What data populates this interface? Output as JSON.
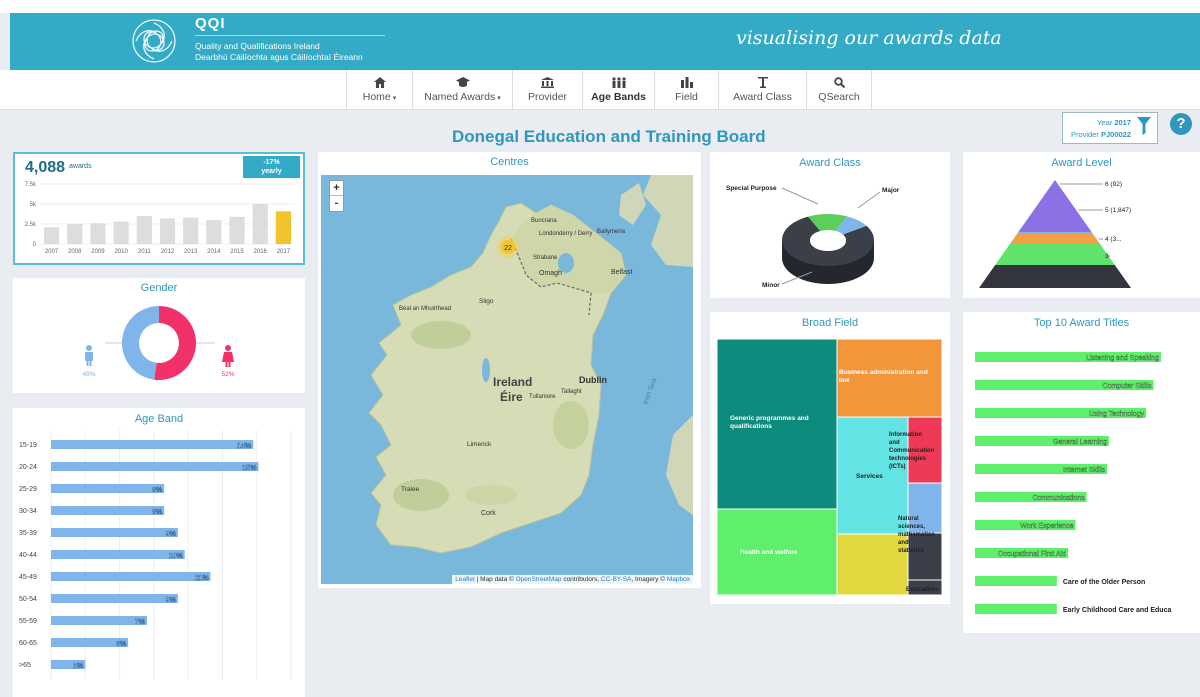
{
  "header": {
    "brand_name": "QQI",
    "brand_line1": "Quality and Qualifications Ireland",
    "brand_line2": "Dearbhú Cáilíochta agus Cáilíochtaí Éireann",
    "tagline": "visualising our awards data",
    "logo_icon": "qqi-swirl-logo",
    "color": "#34abc6"
  },
  "nav": {
    "items": [
      {
        "label": "Home",
        "icon": "home-icon",
        "dropdown": true
      },
      {
        "label": "Named Awards",
        "icon": "mortarboard-icon",
        "dropdown": true
      },
      {
        "label": "Provider",
        "icon": "building-icon",
        "dropdown": false
      },
      {
        "label": "Age Bands",
        "icon": "people-icon",
        "dropdown": false,
        "active": true
      },
      {
        "label": "Field",
        "icon": "bar-chart-icon",
        "dropdown": false
      },
      {
        "label": "Award Class",
        "icon": "award-class-icon",
        "dropdown": false
      },
      {
        "label": "QSearch",
        "icon": "search-icon",
        "dropdown": false
      }
    ]
  },
  "page_title": "Donegal Education and Training Board",
  "filter": {
    "year_label": "Year",
    "year_value": "2017",
    "provider_label": "Provider",
    "provider_value": "PJ00022",
    "icon": "funnel-icon"
  },
  "help_icon": "?",
  "awards_card": {
    "count": "4,088",
    "unit": "awards",
    "change": "-17%",
    "change_period": "yearly"
  },
  "gender_card": {
    "title": "Gender",
    "male_pct": "48%",
    "female_pct": "52%",
    "male_color": "#7fb5ea",
    "female_color": "#f2306a"
  },
  "age_card": {
    "title": "Age Band"
  },
  "map_card": {
    "title": "Centres",
    "cluster_count": "22",
    "zoom_in": "+",
    "zoom_out": "-",
    "attribution_leaflet": "Leaflet",
    "attribution_text": " | Map data © ",
    "attribution_osm": "OpenStreetMap",
    "attribution_mid": " contributors, ",
    "attribution_cc": "CC-BY-SA",
    "attribution_end": ", Imagery © ",
    "attribution_mapbox": "Mapbox",
    "places": [
      {
        "name": "Ireland",
        "kind": "country"
      },
      {
        "name": "Éire",
        "kind": "country"
      },
      {
        "name": "Dublin",
        "kind": "city"
      },
      {
        "name": "Belfast",
        "kind": "city"
      },
      {
        "name": "Londonderry / Derry",
        "kind": "city"
      },
      {
        "name": "Omagh",
        "kind": "town"
      },
      {
        "name": "Sligo",
        "kind": "town"
      },
      {
        "name": "Béal an Mhuirthead",
        "kind": "town"
      },
      {
        "name": "Limerick",
        "kind": "city"
      },
      {
        "name": "Cork",
        "kind": "city"
      },
      {
        "name": "Tralee",
        "kind": "town"
      },
      {
        "name": "Tullamore",
        "kind": "town"
      },
      {
        "name": "Tallaght",
        "kind": "town"
      },
      {
        "name": "Ballymena",
        "kind": "town"
      },
      {
        "name": "Buncrana",
        "kind": "town"
      },
      {
        "name": "Strabane",
        "kind": "town"
      },
      {
        "name": "Irish Sea",
        "kind": "sea"
      }
    ]
  },
  "class_card": {
    "title": "Award Class"
  },
  "level_card": {
    "title": "Award Level"
  },
  "field_card": {
    "title": "Broad Field"
  },
  "top10_card": {
    "title": "Top 10 Award Titles"
  },
  "chart_data": [
    {
      "id": "awards-by-year",
      "type": "bar",
      "categories": [
        "2007",
        "2008",
        "2009",
        "2010",
        "2011",
        "2012",
        "2013",
        "2014",
        "2015",
        "2016",
        "2017"
      ],
      "values": [
        2100,
        2500,
        2600,
        2800,
        3500,
        3200,
        3300,
        3000,
        3400,
        5000,
        4088
      ],
      "yticks": [
        "7.5k",
        "5k",
        "2.5k",
        "0"
      ],
      "ylim": [
        0,
        7500
      ],
      "highlight_index": 10,
      "bar_color": "#dddddd",
      "highlight_color": "#eec52c"
    },
    {
      "id": "gender",
      "type": "pie",
      "labels": [
        "Male",
        "Female"
      ],
      "values": [
        48,
        52
      ],
      "colors": [
        "#7fb5ea",
        "#f2306a"
      ]
    },
    {
      "id": "age-band",
      "type": "bar",
      "orientation": "horizontal",
      "categories": [
        "15-19",
        "20-24",
        "25-29",
        "30-34",
        "35-39",
        "40-44",
        "45-49",
        "50-54",
        "55-59",
        "60-65",
        ">65"
      ],
      "values": [
        590,
        605,
        330,
        330,
        370,
        390,
        465,
        370,
        280,
        225,
        100
      ],
      "labels": [
        "14%",
        "15%",
        "8%",
        "8%",
        "9%",
        "10%",
        "11%",
        "9%",
        "7%",
        "6%",
        "2%"
      ],
      "xticks": [
        "0",
        "100",
        "200",
        "300",
        "400",
        "500",
        "600",
        "700"
      ],
      "xlim": [
        0,
        700
      ],
      "color": "#7fb5ea"
    },
    {
      "id": "award-class",
      "type": "pie",
      "labels": [
        "Special Purpose",
        "Major",
        "Minor"
      ],
      "values": [
        14,
        9,
        77
      ],
      "colors": [
        "#5cce5c",
        "#7fb5ea",
        "#3a3f4a"
      ]
    },
    {
      "id": "award-level",
      "type": "pyramid",
      "labels": [
        "6 (92)",
        "5 (1,847)",
        "4 (3...",
        "3"
      ],
      "values": [
        92,
        1847,
        0,
        0
      ],
      "colors": [
        "#8b70e6",
        "#7fb5ea",
        "#f2a046",
        "#5ee36b",
        "#33363f"
      ]
    },
    {
      "id": "broad-field",
      "type": "treemap",
      "labels": [
        "Generic programmes and qualifications",
        "Business administration and law",
        "Services",
        "Information and Communication technologies (ICTs)",
        "Health and welfare",
        "Natural sciences, mathematics and statistics",
        "Education"
      ],
      "colors": [
        "#0d8c7e",
        "#f2953b",
        "#63e3e3",
        "#ef3a57",
        "#5fef6a",
        "#e2d840",
        "#3a3f4a"
      ]
    },
    {
      "id": "top-10-award-titles",
      "type": "bar",
      "orientation": "horizontal",
      "categories": [
        "Listening and Speaking",
        "Computer Skills",
        "Using Technology",
        "General Learning",
        "Internet Skills",
        "Communications",
        "Work Experience",
        "Occupational First Aid",
        "Care of the Older Person",
        "Early Childhood Care and Educa"
      ],
      "values": [
        100,
        96,
        92,
        72,
        71,
        60,
        54,
        50,
        44,
        44
      ],
      "color": "#5ef06a"
    }
  ]
}
